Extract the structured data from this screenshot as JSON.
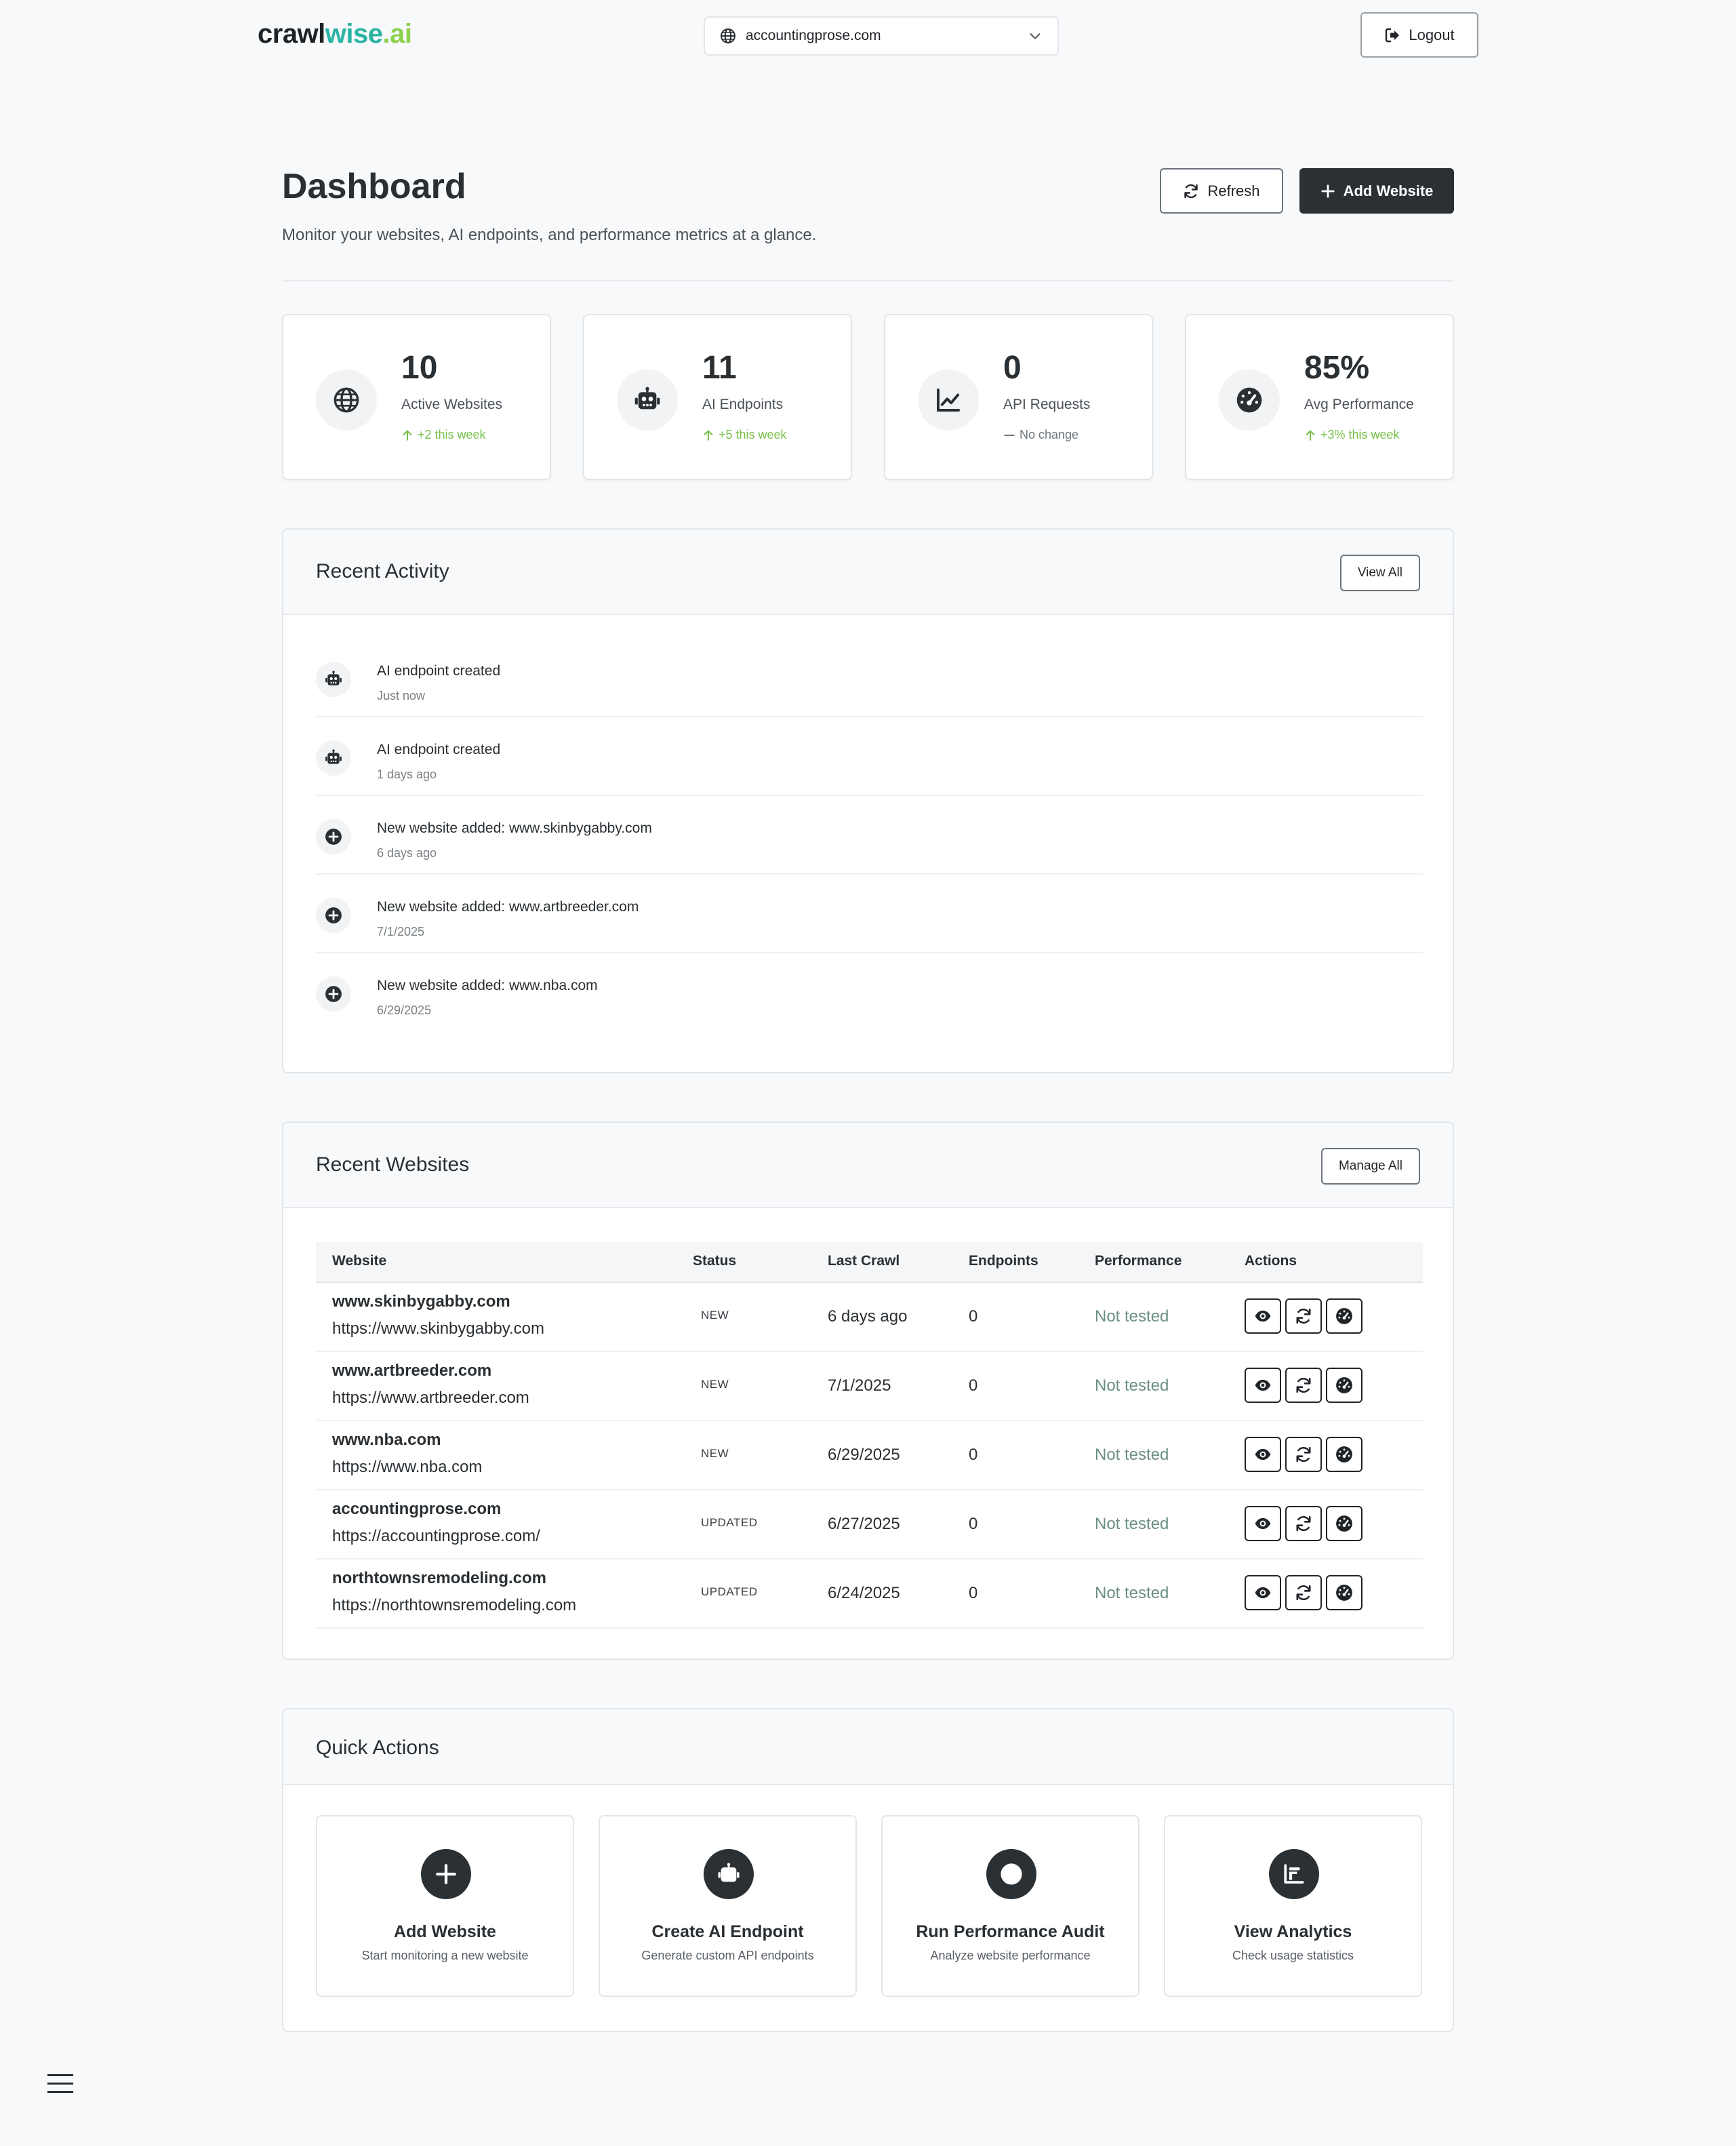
{
  "brand": {
    "part1": "crawl",
    "part2": "wise",
    "part3": ".ai"
  },
  "site_selector": {
    "value": "accountingprose.com",
    "icon": "globe-icon"
  },
  "logout_label": "Logout",
  "header": {
    "title": "Dashboard",
    "subtitle": "Monitor your websites, AI endpoints, and performance metrics at a glance.",
    "refresh_label": "Refresh",
    "add_website_label": "Add Website"
  },
  "stats": [
    {
      "value": "10",
      "label": "Active Websites",
      "change": "+2 this week",
      "icon": "globe-icon",
      "trend": "up"
    },
    {
      "value": "11",
      "label": "AI Endpoints",
      "change": "+5 this week",
      "icon": "robot-icon",
      "trend": "up"
    },
    {
      "value": "0",
      "label": "API Requests",
      "change": "No change",
      "icon": "chart-line-icon",
      "trend": "none"
    },
    {
      "value": "85%",
      "label": "Avg Performance",
      "change": "+3% this week",
      "icon": "gauge-icon",
      "trend": "up"
    }
  ],
  "recent_activity": {
    "title": "Recent Activity",
    "view_all_label": "View All",
    "items": [
      {
        "title": "AI endpoint created",
        "time": "Just now",
        "icon": "robot-icon"
      },
      {
        "title": "AI endpoint created",
        "time": "1 days ago",
        "icon": "robot-icon"
      },
      {
        "title": "New website added: www.skinbygabby.com",
        "time": "6 days ago",
        "icon": "plus-circle-icon"
      },
      {
        "title": "New website added: www.artbreeder.com",
        "time": "7/1/2025",
        "icon": "plus-circle-icon"
      },
      {
        "title": "New website added: www.nba.com",
        "time": "6/29/2025",
        "icon": "plus-circle-icon"
      }
    ]
  },
  "recent_websites": {
    "title": "Recent Websites",
    "manage_all_label": "Manage All",
    "columns": [
      "Website",
      "Status",
      "Last Crawl",
      "Endpoints",
      "Performance",
      "Actions"
    ],
    "rows": [
      {
        "name": "www.skinbygabby.com",
        "url": "https://www.skinbygabby.com",
        "status": "NEW",
        "last_crawl": "6 days ago",
        "endpoints": "0",
        "performance": "Not tested"
      },
      {
        "name": "www.artbreeder.com",
        "url": "https://www.artbreeder.com",
        "status": "NEW",
        "last_crawl": "7/1/2025",
        "endpoints": "0",
        "performance": "Not tested"
      },
      {
        "name": "www.nba.com",
        "url": "https://www.nba.com",
        "status": "NEW",
        "last_crawl": "6/29/2025",
        "endpoints": "0",
        "performance": "Not tested"
      },
      {
        "name": "accountingprose.com",
        "url": "https://accountingprose.com/",
        "status": "UPDATED",
        "last_crawl": "6/27/2025",
        "endpoints": "0",
        "performance": "Not tested"
      },
      {
        "name": "northtownsremodeling.com",
        "url": "https://northtownsremodeling.com",
        "status": "UPDATED",
        "last_crawl": "6/24/2025",
        "endpoints": "0",
        "performance": "Not tested"
      }
    ]
  },
  "quick_actions": {
    "title": "Quick Actions",
    "items": [
      {
        "title": "Add Website",
        "desc": "Start monitoring a new website",
        "icon": "plus-icon"
      },
      {
        "title": "Create AI Endpoint",
        "desc": "Generate custom API endpoints",
        "icon": "robot-icon"
      },
      {
        "title": "Run Performance Audit",
        "desc": "Analyze website performance",
        "icon": "gauge-icon"
      },
      {
        "title": "View Analytics",
        "desc": "Check usage statistics",
        "icon": "bar-chart-icon"
      }
    ]
  },
  "colors": {
    "accent_dark": "#2a3034",
    "positive": "#77c04a",
    "brand_teal": "#2bb3a3",
    "brand_green": "#8bd14d"
  }
}
